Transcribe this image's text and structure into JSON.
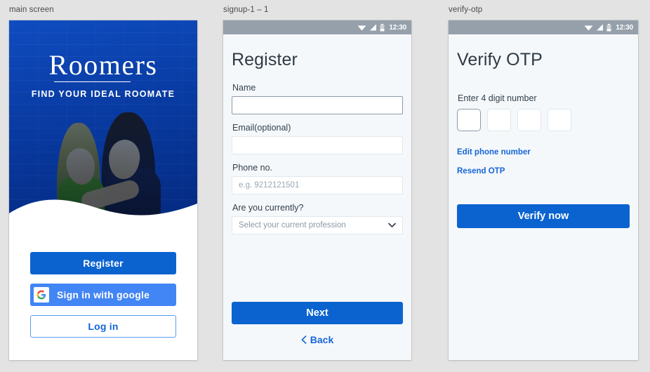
{
  "page": {
    "background": "#e3e3e3"
  },
  "colors": {
    "primary_blue": "#0b63d0",
    "google_blue": "#4285f4",
    "link_blue": "#1565d8",
    "hero_blue": "#1263c9",
    "statusbar_gray": "#95a0ab"
  },
  "frames": [
    {
      "label": "main screen"
    },
    {
      "label": "signup-1 – 1"
    },
    {
      "label": "verify-otp"
    }
  ],
  "statusbar": {
    "time": "12:30",
    "icons": [
      "wifi-icon",
      "signal-icon",
      "battery-icon"
    ]
  },
  "main_screen": {
    "brand": "Roomers",
    "tagline": "FIND YOUR IDEAL ROOMATE",
    "buttons": {
      "register": "Register",
      "google": "Sign in with google",
      "login": "Log in"
    }
  },
  "signup_screen": {
    "title": "Register",
    "fields": [
      {
        "label": "Name",
        "value": "",
        "placeholder": "",
        "focused": true
      },
      {
        "label": "Email(optional)",
        "value": "",
        "placeholder": "",
        "focused": false
      },
      {
        "label": "Phone no.",
        "value": "",
        "placeholder": "e.g. 9212121501",
        "focused": false
      }
    ],
    "profession": {
      "label": "Are you currently?",
      "selected": "Select your current profession"
    },
    "next_label": "Next",
    "back_label": "Back"
  },
  "otp_screen": {
    "title": "Verify OTP",
    "hint": "Enter 4 digit number",
    "boxes": [
      {
        "value": "",
        "focused": true
      },
      {
        "value": "",
        "focused": false
      },
      {
        "value": "",
        "focused": false
      },
      {
        "value": "",
        "focused": false
      }
    ],
    "edit_phone_label": "Edit phone number",
    "resend_label": "Resend OTP",
    "verify_label": "Verify now"
  }
}
